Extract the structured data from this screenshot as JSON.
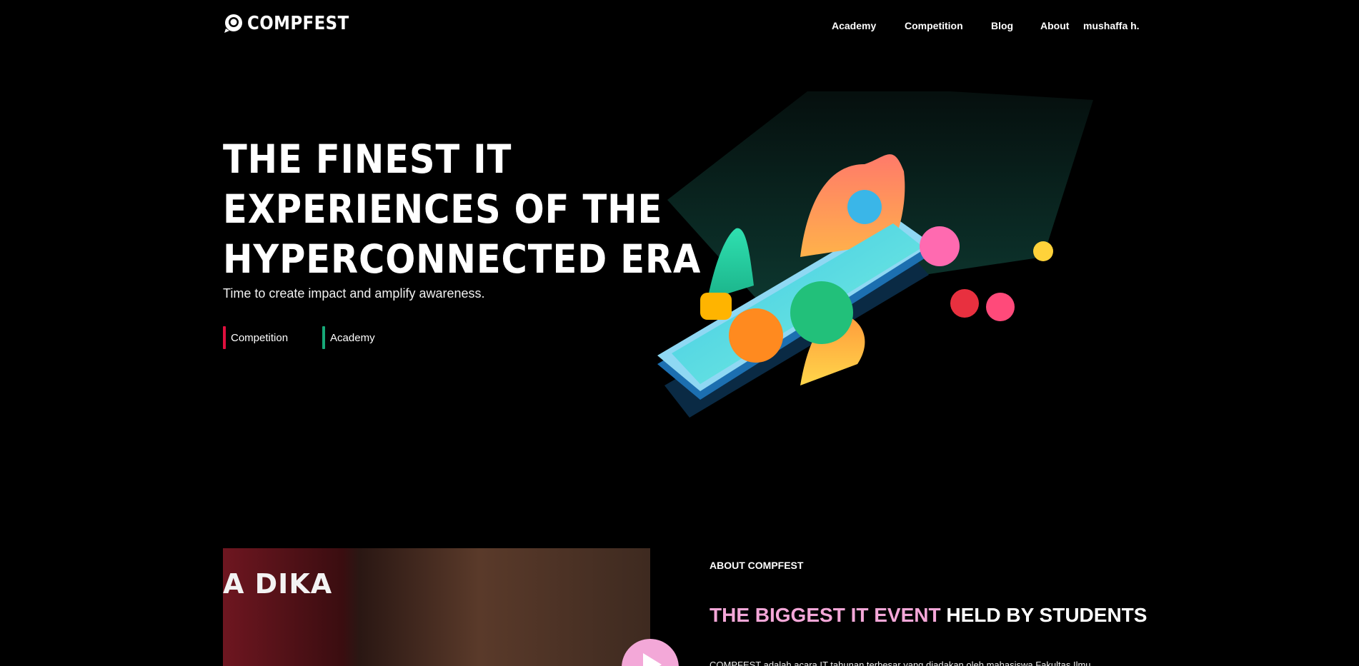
{
  "nav": {
    "brand": "COMPFEST",
    "links": [
      {
        "label": "Academy"
      },
      {
        "label": "Competition"
      },
      {
        "label": "Blog"
      },
      {
        "label": "About"
      }
    ],
    "user": "mushaffa h."
  },
  "hero": {
    "title_lines": [
      "THE FINEST IT",
      "EXPERIENCES OF THE",
      "HYPERCONNECTED ERA"
    ],
    "subtitle": "Time to create impact and amplify awareness.",
    "links": [
      {
        "label": "Competition",
        "color": "#e0103e"
      },
      {
        "label": "Academy",
        "color": "#17a878"
      }
    ]
  },
  "about": {
    "video_caption": "A DIKA",
    "eyebrow": "ABOUT COMPFEST",
    "title_highlight": "THE BIGGEST IT EVENT",
    "title_rest": "HELD BY STUDENTS",
    "body": "COMPFEST adalah acara IT tahunan terbesar yang diadakan oleh mahasiswa Fakultas Ilmu"
  },
  "colors": {
    "background": "#000000",
    "accent_pink": "#f4a7d8",
    "competition_red": "#e0103e",
    "academy_green": "#17a878"
  }
}
